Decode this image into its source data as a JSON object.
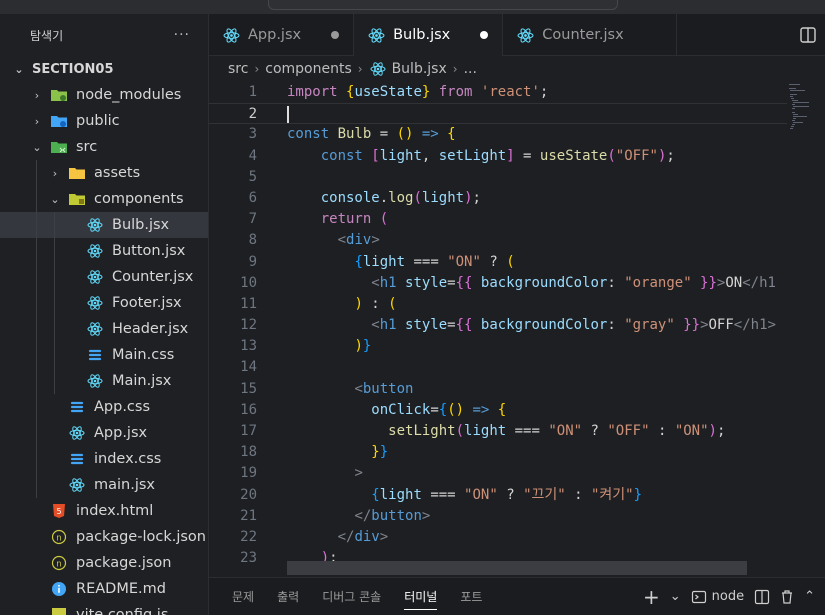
{
  "explorer": {
    "title": "탐색기",
    "more_label": "···",
    "project": "SECTION05",
    "items": [
      {
        "label": "node_modules",
        "kind": "folder-node",
        "depth": 1,
        "chev": "›"
      },
      {
        "label": "public",
        "kind": "folder-public",
        "depth": 1,
        "chev": "›"
      },
      {
        "label": "src",
        "kind": "folder-src",
        "depth": 1,
        "chev": "⌄"
      },
      {
        "label": "assets",
        "kind": "folder-assets",
        "depth": 2,
        "chev": "›"
      },
      {
        "label": "components",
        "kind": "folder-components",
        "depth": 2,
        "chev": "⌄"
      },
      {
        "label": "Bulb.jsx",
        "kind": "react",
        "depth": 3,
        "selected": true
      },
      {
        "label": "Button.jsx",
        "kind": "react",
        "depth": 3
      },
      {
        "label": "Counter.jsx",
        "kind": "react",
        "depth": 3
      },
      {
        "label": "Footer.jsx",
        "kind": "react",
        "depth": 3
      },
      {
        "label": "Header.jsx",
        "kind": "react",
        "depth": 3
      },
      {
        "label": "Main.css",
        "kind": "css",
        "depth": 3
      },
      {
        "label": "Main.jsx",
        "kind": "react",
        "depth": 3
      },
      {
        "label": "App.css",
        "kind": "css",
        "depth": 2
      },
      {
        "label": "App.jsx",
        "kind": "react",
        "depth": 2
      },
      {
        "label": "index.css",
        "kind": "css",
        "depth": 2
      },
      {
        "label": "main.jsx",
        "kind": "react",
        "depth": 2
      },
      {
        "label": "index.html",
        "kind": "html",
        "depth": 1
      },
      {
        "label": "package-lock.json",
        "kind": "json",
        "depth": 1
      },
      {
        "label": "package.json",
        "kind": "json",
        "depth": 1
      },
      {
        "label": "README.md",
        "kind": "info",
        "depth": 1
      },
      {
        "label": "vite.config.js",
        "kind": "js",
        "depth": 1
      }
    ]
  },
  "tabs": [
    {
      "label": "App.jsx",
      "active": false,
      "dirty": true
    },
    {
      "label": "Bulb.jsx",
      "active": true,
      "dirty": true
    },
    {
      "label": "Counter.jsx",
      "active": false,
      "dirty": false
    }
  ],
  "breadcrumb": {
    "root": "src",
    "folder": "components",
    "file": "Bulb.jsx",
    "more": "..."
  },
  "editor": {
    "current_line": 2,
    "lines": [
      [
        [
          "k",
          "import "
        ],
        [
          "br1",
          "{"
        ],
        [
          "v",
          "useState"
        ],
        [
          "br1",
          "}"
        ],
        [
          "k",
          " from "
        ],
        [
          "s",
          "'react'"
        ],
        [
          "pl",
          ";"
        ]
      ],
      [],
      [
        [
          "kb",
          "const "
        ],
        [
          "fn",
          "Bulb"
        ],
        [
          "pl",
          " = "
        ],
        [
          "br1",
          "()"
        ],
        [
          "kb",
          " => "
        ],
        [
          "br1",
          "{"
        ]
      ],
      [
        [
          "pl",
          "    "
        ],
        [
          "kb",
          "const "
        ],
        [
          "br2",
          "["
        ],
        [
          "v",
          "light"
        ],
        [
          "pl",
          ", "
        ],
        [
          "v",
          "setLight"
        ],
        [
          "br2",
          "]"
        ],
        [
          "pl",
          " = "
        ],
        [
          "fn",
          "useState"
        ],
        [
          "br2",
          "("
        ],
        [
          "s",
          "\"OFF\""
        ],
        [
          "br2",
          ")"
        ],
        [
          "pl",
          ";"
        ]
      ],
      [],
      [
        [
          "pl",
          "    "
        ],
        [
          "v",
          "console"
        ],
        [
          "pl",
          "."
        ],
        [
          "fn",
          "log"
        ],
        [
          "br2",
          "("
        ],
        [
          "v",
          "light"
        ],
        [
          "br2",
          ")"
        ],
        [
          "pl",
          ";"
        ]
      ],
      [
        [
          "pl",
          "    "
        ],
        [
          "k",
          "return "
        ],
        [
          "br2",
          "("
        ]
      ],
      [
        [
          "pl",
          "      "
        ],
        [
          "tagc",
          "<"
        ],
        [
          "kb",
          "div"
        ],
        [
          "tagc",
          ">"
        ]
      ],
      [
        [
          "pl",
          "        "
        ],
        [
          "br3",
          "{"
        ],
        [
          "v",
          "light"
        ],
        [
          "pl",
          " === "
        ],
        [
          "s",
          "\"ON\""
        ],
        [
          "pl",
          " ? "
        ],
        [
          "br1",
          "("
        ]
      ],
      [
        [
          "pl",
          "          "
        ],
        [
          "tagc",
          "<"
        ],
        [
          "kb",
          "h1"
        ],
        [
          "v",
          " style"
        ],
        [
          "pl",
          "="
        ],
        [
          "br2",
          "{{"
        ],
        [
          "v",
          " backgroundColor"
        ],
        [
          "pl",
          ": "
        ],
        [
          "s",
          "\"orange\""
        ],
        [
          "br2",
          " }}"
        ],
        [
          "tagc",
          ">"
        ],
        [
          "pl",
          "ON"
        ],
        [
          "tagc",
          "</h1"
        ]
      ],
      [
        [
          "pl",
          "        "
        ],
        [
          "br1",
          ")"
        ],
        [
          "pl",
          " : "
        ],
        [
          "br1",
          "("
        ]
      ],
      [
        [
          "pl",
          "          "
        ],
        [
          "tagc",
          "<"
        ],
        [
          "kb",
          "h1"
        ],
        [
          "v",
          " style"
        ],
        [
          "pl",
          "="
        ],
        [
          "br2",
          "{{"
        ],
        [
          "v",
          " backgroundColor"
        ],
        [
          "pl",
          ": "
        ],
        [
          "s",
          "\"gray\""
        ],
        [
          "br2",
          " }}"
        ],
        [
          "tagc",
          ">"
        ],
        [
          "pl",
          "OFF"
        ],
        [
          "tagc",
          "</h1>"
        ]
      ],
      [
        [
          "pl",
          "        "
        ],
        [
          "br1",
          ")"
        ],
        [
          "br3",
          "}"
        ]
      ],
      [],
      [
        [
          "pl",
          "        "
        ],
        [
          "tagc",
          "<"
        ],
        [
          "kb",
          "button"
        ]
      ],
      [
        [
          "pl",
          "          "
        ],
        [
          "v",
          "onClick"
        ],
        [
          "pl",
          "="
        ],
        [
          "br3",
          "{"
        ],
        [
          "br1",
          "()"
        ],
        [
          "kb",
          " => "
        ],
        [
          "br1",
          "{"
        ]
      ],
      [
        [
          "pl",
          "            "
        ],
        [
          "fn",
          "setLight"
        ],
        [
          "br2",
          "("
        ],
        [
          "v",
          "light"
        ],
        [
          "pl",
          " === "
        ],
        [
          "s",
          "\"ON\""
        ],
        [
          "pl",
          " ? "
        ],
        [
          "s",
          "\"OFF\""
        ],
        [
          "pl",
          " : "
        ],
        [
          "s",
          "\"ON\""
        ],
        [
          "br2",
          ")"
        ],
        [
          "pl",
          ";"
        ]
      ],
      [
        [
          "pl",
          "          "
        ],
        [
          "br1",
          "}"
        ],
        [
          "br3",
          "}"
        ]
      ],
      [
        [
          "pl",
          "        "
        ],
        [
          "tagc",
          ">"
        ]
      ],
      [
        [
          "pl",
          "          "
        ],
        [
          "br3",
          "{"
        ],
        [
          "v",
          "light"
        ],
        [
          "pl",
          " === "
        ],
        [
          "s",
          "\"ON\""
        ],
        [
          "pl",
          " ? "
        ],
        [
          "s",
          "\"끄기\""
        ],
        [
          "pl",
          " : "
        ],
        [
          "s",
          "\"켜기\""
        ],
        [
          "br3",
          "}"
        ]
      ],
      [
        [
          "pl",
          "        "
        ],
        [
          "tagc",
          "</"
        ],
        [
          "kb",
          "button"
        ],
        [
          "tagc",
          ">"
        ]
      ],
      [
        [
          "pl",
          "      "
        ],
        [
          "tagc",
          "</"
        ],
        [
          "kb",
          "div"
        ],
        [
          "tagc",
          ">"
        ]
      ],
      [
        [
          "pl",
          "    "
        ],
        [
          "br2",
          ")"
        ],
        [
          "pl",
          ";"
        ]
      ]
    ]
  },
  "panel": {
    "tabs": [
      {
        "label": "문제",
        "active": false
      },
      {
        "label": "출력",
        "active": false
      },
      {
        "label": "디버그 콘솔",
        "active": false
      },
      {
        "label": "터미널",
        "active": true
      },
      {
        "label": "포트",
        "active": false
      }
    ],
    "terminal_name": "node",
    "add_label": "+",
    "dropdown_label": "⌄",
    "maximize_label": "⌃"
  },
  "colors": {
    "react": "#61dafb",
    "css": "#42a5f5",
    "html": "#e44d26",
    "json": "#cbcb41",
    "folder": "#e8b64b",
    "accent_white": "#ffffff"
  }
}
